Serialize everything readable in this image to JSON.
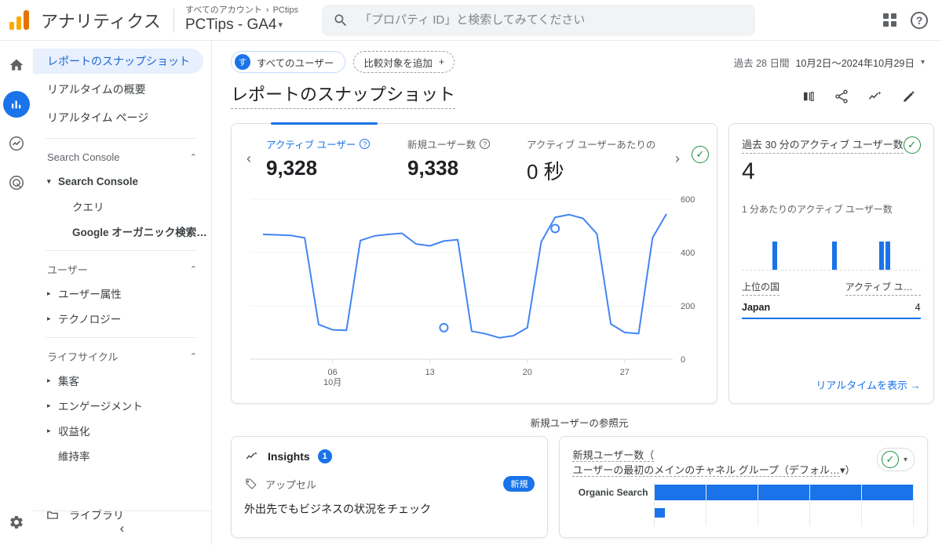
{
  "topbar": {
    "brand": "アナリティクス",
    "breadcrumb_all": "すべてのアカウント",
    "breadcrumb_sep": "›",
    "breadcrumb_prop": "PCtips",
    "property_name": "PCTips - GA4",
    "property_caret": "▾",
    "search_placeholder": "「プロパティ ID」と検索してみてください",
    "help_glyph": "?"
  },
  "rail": {
    "items": [
      {
        "name": "home-icon",
        "label": "ホーム"
      },
      {
        "name": "reports-icon",
        "label": "レポート"
      },
      {
        "name": "explore-icon",
        "label": "探索"
      },
      {
        "name": "advertising-icon",
        "label": "広告"
      }
    ],
    "settings_label": "管理"
  },
  "nav": {
    "items": [
      {
        "label": "レポートのスナップショット",
        "selected": true
      },
      {
        "label": "リアルタイムの概要",
        "selected": false
      },
      {
        "label": "リアルタイム ページ",
        "selected": false
      }
    ],
    "group_search_console": "Search Console",
    "search_console_item": "Search Console",
    "search_console_children": [
      "クエリ",
      "Google オーガニック検索レ…"
    ],
    "group_user": "ユーザー",
    "user_children": [
      "ユーザー属性",
      "テクノロジー"
    ],
    "group_lifecycle": "ライフサイクル",
    "lifecycle_children": [
      "集客",
      "エンゲージメント",
      "収益化"
    ],
    "retention": "維持率",
    "library": "ライブラリ",
    "collapse_glyph": "‹",
    "chevron_up": "⌃",
    "triangle_right": "▸",
    "triangle_down": "▾"
  },
  "toolbar": {
    "audience_initial": "す",
    "audience_label": "すべてのユーザー",
    "compare_label": "比較対象を追加",
    "compare_plus": "+",
    "date_pill": "過去 28 日間",
    "date_range": "10月2日〜2024年10月29日",
    "date_caret": "▾"
  },
  "page": {
    "title": "レポートのスナップショット",
    "actions": [
      {
        "name": "customize-icon",
        "label": "カスタマイズ"
      },
      {
        "name": "share-icon",
        "label": "共有"
      },
      {
        "name": "insights-icon",
        "label": "インサイト"
      },
      {
        "name": "edit-icon",
        "label": "編集"
      }
    ]
  },
  "overview_card": {
    "prev_glyph": "‹",
    "next_glyph": "›",
    "metrics": [
      {
        "label": "アクティブ ユーザー",
        "value": "9,328",
        "help": "?"
      },
      {
        "label": "新規ユーザー数",
        "value": "9,338",
        "help": "?"
      },
      {
        "label": "アクティブ ユーザーあたりの",
        "value": "0 秒",
        "help": ""
      }
    ],
    "status_glyph": "✓"
  },
  "chart_data": {
    "type": "line",
    "title": "アクティブ ユーザー",
    "xlabel": "10月",
    "ylabel": "",
    "ylim": [
      0,
      600
    ],
    "yticks": [
      0,
      200,
      400,
      600
    ],
    "ytick_labels": [
      "0",
      "200",
      "400",
      "600"
    ],
    "xticks": [
      5,
      12,
      19,
      26
    ],
    "xtick_labels": [
      "06",
      "13",
      "20",
      "27"
    ],
    "x_axis_note": "10月",
    "grid": true,
    "color": "#4285F4",
    "x": [
      1,
      2,
      3,
      4,
      5,
      6,
      7,
      8,
      9,
      10,
      11,
      12,
      13,
      14,
      15,
      16,
      17,
      18,
      19,
      20,
      21,
      22,
      23,
      24,
      25,
      26,
      27,
      28,
      29
    ],
    "values": [
      468,
      466,
      464,
      455,
      130,
      110,
      108,
      445,
      462,
      468,
      472,
      432,
      425,
      443,
      448,
      105,
      95,
      80,
      88,
      118,
      440,
      532,
      542,
      528,
      470,
      132,
      100,
      96,
      455,
      545
    ],
    "markers": [
      {
        "x": 13,
        "y": 118
      },
      {
        "x": 21,
        "y": 490
      }
    ]
  },
  "realtime_card": {
    "title": "過去 30 分のアクティブ ユーザー数",
    "value": "4",
    "bars_label": "1 分あたりのアクティブ ユーザー数",
    "bars": [
      0,
      0,
      0,
      0,
      0,
      36,
      0,
      0,
      0,
      0,
      0,
      0,
      0,
      0,
      0,
      36,
      0,
      0,
      0,
      0,
      0,
      0,
      0,
      36,
      36,
      0,
      0,
      0,
      0,
      0
    ],
    "table_header_country": "上位の国",
    "table_header_users": "アクティブ ユーザ…",
    "rows": [
      {
        "country": "Japan",
        "users": "4"
      }
    ],
    "link_label": "リアルタイムを表示",
    "link_arrow": "→",
    "status_glyph": "✓"
  },
  "insights_card": {
    "header": "Insights",
    "count": "1",
    "tag": "アップセル",
    "badge": "新規",
    "body": "外出先でもビジネスの状況をチェック"
  },
  "sources_section": {
    "section_label": "新規ユーザーの参照元",
    "title_line1": "新規ユーザー数（",
    "title_line2": "ユーザーの最初のメインのチャネル グループ（デフォル…",
    "title_caret": "▾",
    "title_close": "）",
    "status_glyph": "✓",
    "dropdown_caret": "▾",
    "bar_chart": {
      "type": "bar",
      "orientation": "horizontal",
      "categories": [
        "Organic Search"
      ],
      "values": [
        100
      ],
      "max": 115,
      "color": "#1a73e8"
    }
  }
}
